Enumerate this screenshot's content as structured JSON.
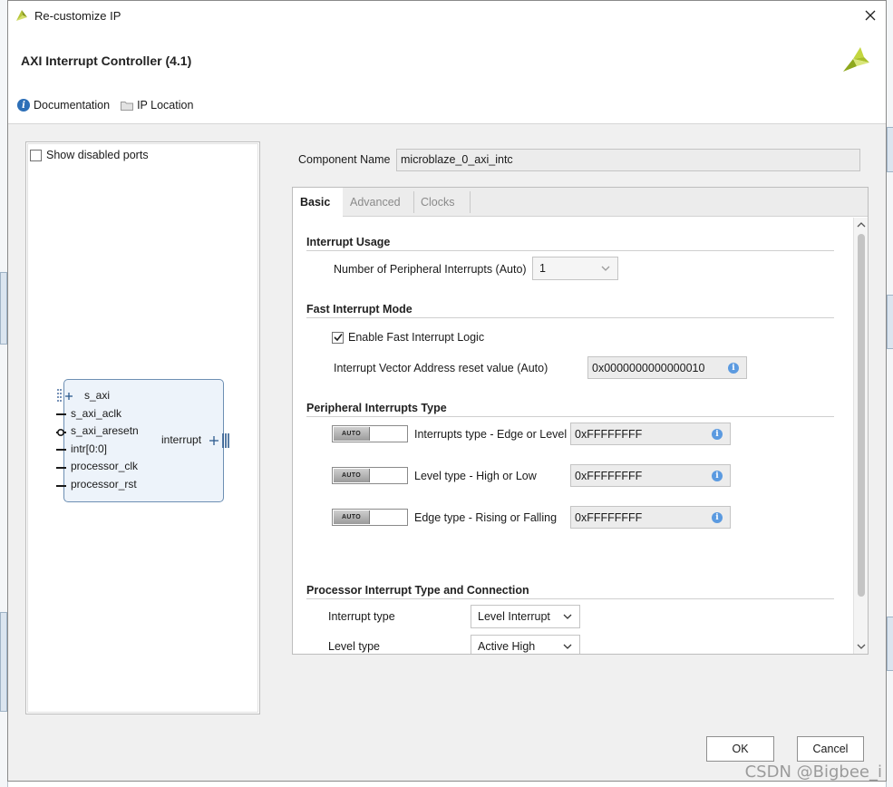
{
  "window": {
    "title": "Re-customize IP"
  },
  "header": {
    "ip_title": "AXI Interrupt Controller (4.1)",
    "documentation_label": "Documentation",
    "ip_location_label": "IP Location"
  },
  "symbol_panel": {
    "show_disabled_ports_label": "Show disabled ports",
    "show_disabled_ports_checked": false,
    "ports_left": [
      "s_axi",
      "s_axi_aclk",
      "s_axi_aresetn",
      "intr[0:0]",
      "processor_clk",
      "processor_rst"
    ],
    "port_right": "interrupt"
  },
  "component": {
    "label": "Component Name",
    "value": "microblaze_0_axi_intc"
  },
  "tabs": [
    {
      "label": "Basic",
      "active": true
    },
    {
      "label": "Advanced",
      "active": false
    },
    {
      "label": "Clocks",
      "active": false
    }
  ],
  "interrupt_usage": {
    "title": "Interrupt Usage",
    "num_label": "Number of Peripheral Interrupts (Auto)",
    "num_value": "1"
  },
  "fast_interrupt": {
    "title": "Fast Interrupt Mode",
    "enable_label": "Enable Fast Interrupt Logic",
    "enable_checked": true,
    "vector_label": "Interrupt Vector Address reset value (Auto)",
    "vector_value": "0x0000000000000010"
  },
  "peripheral_type": {
    "title": "Peripheral Interrupts Type",
    "toggle_text": "AUTO",
    "rows": [
      {
        "label": "Interrupts type - Edge or Level",
        "value": "0xFFFFFFFF"
      },
      {
        "label": "Level type - High or Low",
        "value": "0xFFFFFFFF"
      },
      {
        "label": "Edge type - Rising or Falling",
        "value": "0xFFFFFFFF"
      }
    ]
  },
  "processor": {
    "title": "Processor Interrupt Type and Connection",
    "interrupt_type_label": "Interrupt type",
    "interrupt_type_value": "Level Interrupt",
    "level_type_label": "Level type",
    "level_type_value": "Active High"
  },
  "buttons": {
    "ok": "OK",
    "cancel": "Cancel"
  },
  "watermark": "CSDN @Bigbee_i",
  "colors": {
    "accent": "#2d6fb7",
    "block_fill": "#edf3fa",
    "block_border": "#6d8fb3"
  }
}
